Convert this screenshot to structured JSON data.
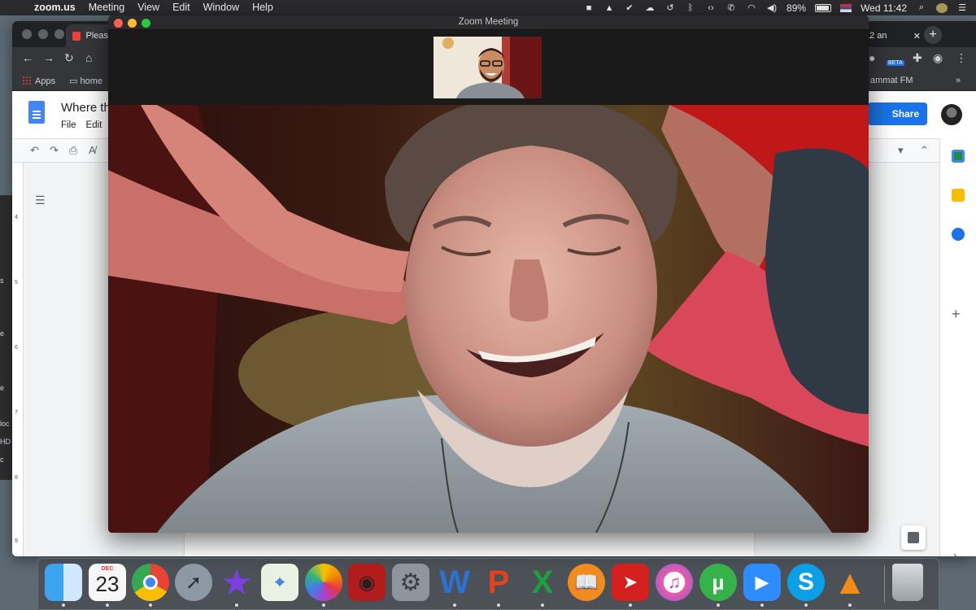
{
  "menubar": {
    "app_name": "zoom.us",
    "menus": [
      "Meeting",
      "View",
      "Edit",
      "Window",
      "Help"
    ],
    "battery": "89%",
    "clock": "Wed 11:42"
  },
  "chrome": {
    "tab_left_label": "Pleas",
    "tab_right_label": "12 an",
    "bookmarks": {
      "apps": "Apps",
      "home": "home",
      "right": "ammat FM"
    },
    "beta_badge": "BETA"
  },
  "docs": {
    "title": "Where th",
    "menu": [
      "File",
      "Edit"
    ],
    "share_label": "Share",
    "ruler_marks": [
      "4",
      "5",
      "6",
      "7",
      "8",
      "9"
    ]
  },
  "left_window_fragments": [
    "s",
    "e",
    "e",
    "loc",
    "HD",
    "c"
  ],
  "zoom": {
    "window_title": "Zoom Meeting"
  },
  "dock": {
    "calendar_month": "DEC",
    "calendar_day": "23",
    "apps": [
      "finder",
      "calendar",
      "chrome",
      "launchpad",
      "imovie",
      "maps",
      "photos",
      "photo-booth",
      "system-preferences",
      "word",
      "powerpoint",
      "excel",
      "books",
      "pdf",
      "itunes",
      "utorrent",
      "zoom",
      "skype",
      "vlc"
    ]
  },
  "colors": {
    "zoom_bg": "#141414",
    "chrome_dark": "#202124",
    "docs_blue": "#1a73e8",
    "traffic_red": "#ff5f57",
    "traffic_yellow": "#febc2e",
    "traffic_green": "#28c840"
  }
}
